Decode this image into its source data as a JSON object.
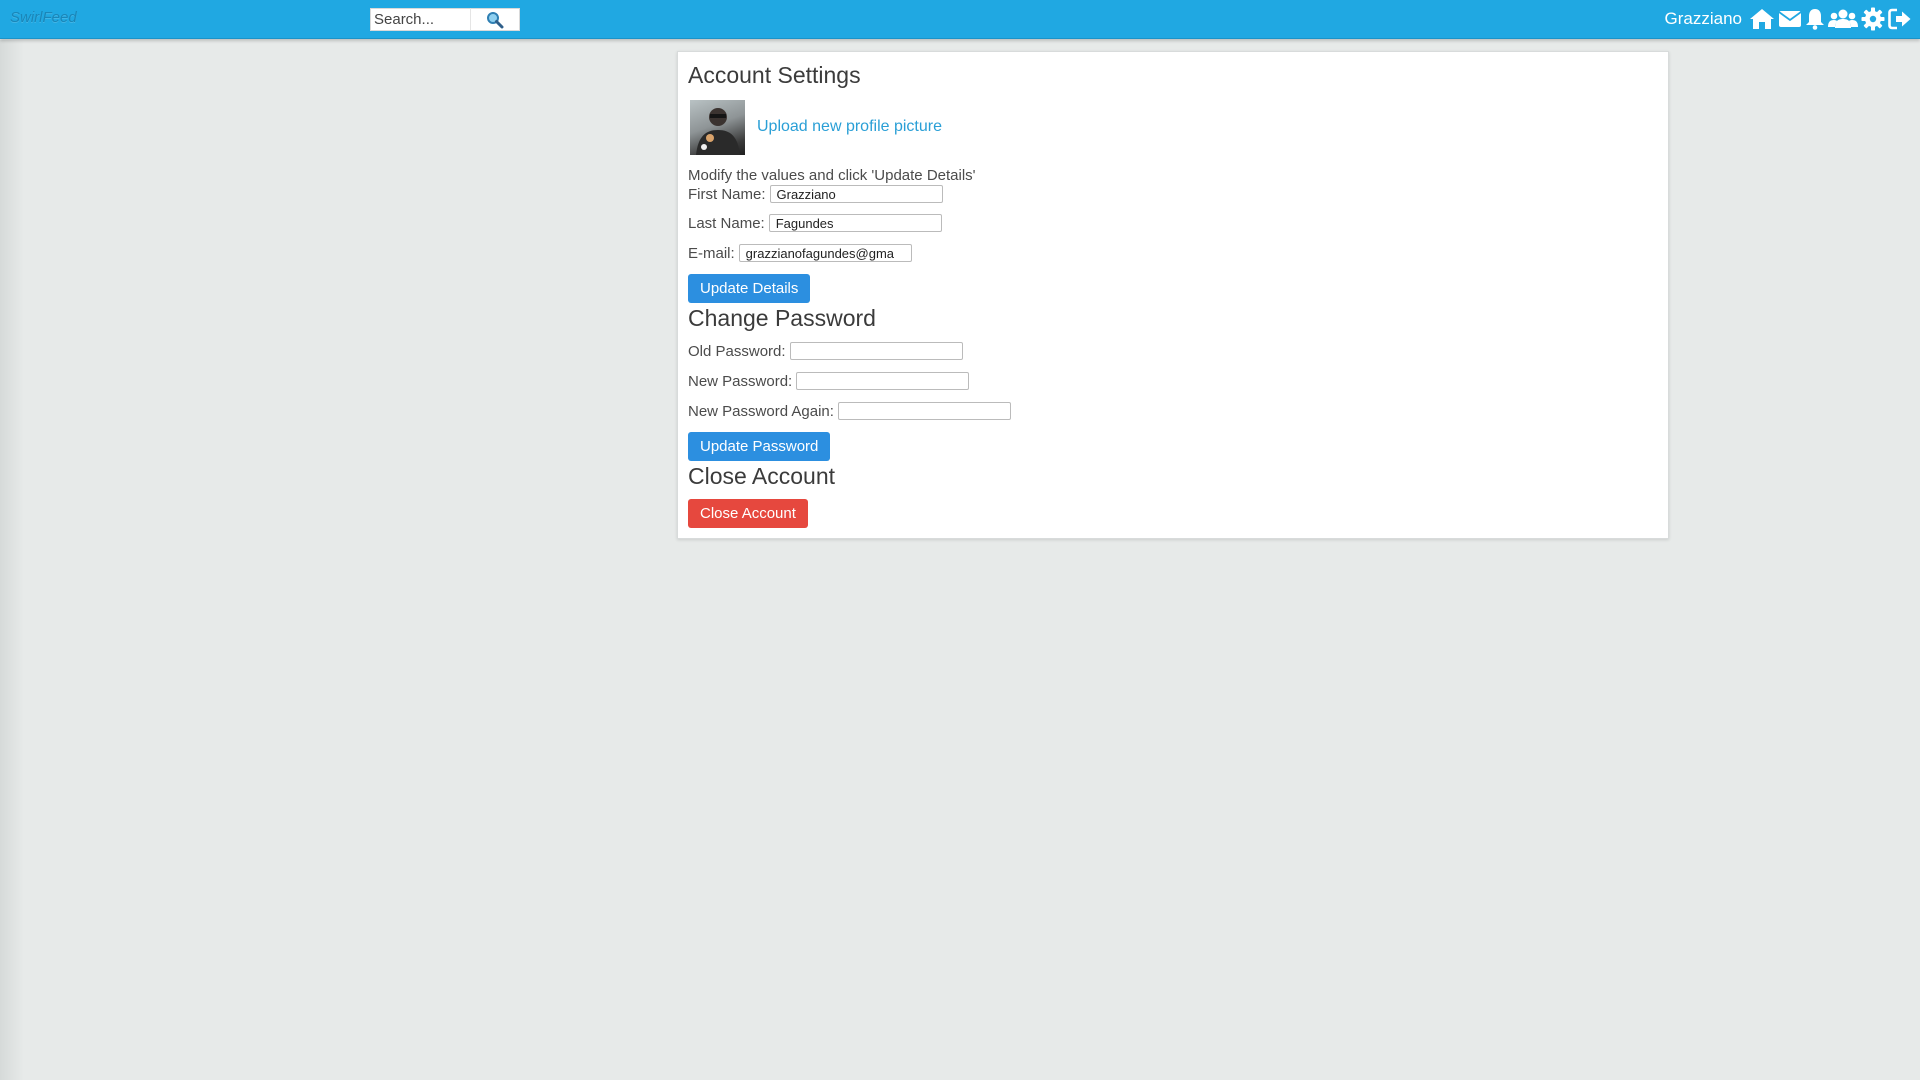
{
  "header": {
    "logo": "SwirlFeed",
    "search_placeholder": "Search...",
    "username": "Grazziano"
  },
  "colors": {
    "topbar": "#20a8e2",
    "link": "#2a9fd6",
    "primary_button": "#2c8fe0",
    "danger_button": "#e6483e",
    "page_background": "#e7eae9"
  },
  "icons": [
    "search-icon",
    "home-icon",
    "envelope-icon",
    "bell-icon",
    "users-icon",
    "gear-icon",
    "sign-out-icon"
  ],
  "account": {
    "title": "Account Settings",
    "upload_link": "Upload new profile picture",
    "instructions": "Modify the values and click 'Update Details'",
    "first_name_label": "First Name:",
    "first_name_value": "Grazziano",
    "last_name_label": "Last Name:",
    "last_name_value": "Fagundes",
    "email_label": "E-mail:",
    "email_value": "grazzianofagundes@gma",
    "update_details_button": "Update Details"
  },
  "password": {
    "title": "Change Password",
    "old_label": "Old Password:",
    "new_label": "New Password:",
    "again_label": "New Password Again:",
    "update_button": "Update Password"
  },
  "close": {
    "title": "Close Account",
    "button": "Close Account"
  }
}
